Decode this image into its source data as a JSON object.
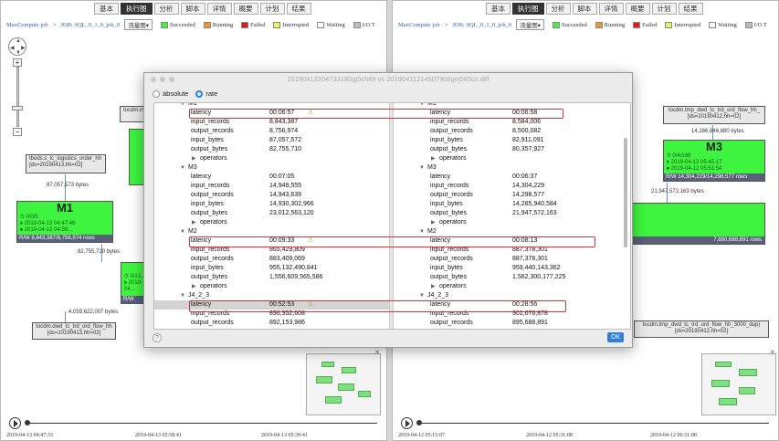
{
  "tabs": [
    "基本",
    "执行图",
    "分析",
    "脚本",
    "详情",
    "概要",
    "计划",
    "结果"
  ],
  "active_tab_index": 1,
  "left": {
    "breadcrumb_root": "MaxCompute job",
    "breadcrumb_sep": ">",
    "breadcrumb_job": "JOB: SQL_0_1_0_job_0",
    "view_select": "流量图",
    "node_top_a": "tocdm.mp...",
    "node_src_line1": "tbods.s_lc_logistics_order_hh",
    "node_src_line2": "[ds=20190413,hh=02]",
    "edge_src_label": "87,057,573 bytes",
    "m1_title": "M1",
    "m1_line1": "⏱ 0/0/5",
    "m1_line2": "⏵ 2019-04-13 04:47:46",
    "m1_line3": "⏹ 2019-04-13 04:56:..",
    "m1_rw": "R/W  8,843,387/8,756,974 rows",
    "m2_line1": "⏱ 0/13...",
    "m2_line2": "⏵ 2019-04...",
    "m2_rw": "R/W",
    "edge_m1_label": "82,755,710 bytes",
    "edge_out_label": "4,059,622,007 bytes",
    "sink_line1": "tocdm.dwd_tc_trd_ord_flow_hh",
    "sink_line2": "[ds=20190413,hh=02]",
    "mid_stub": "R/W",
    "time_start": "2019-04-13 04:47:33",
    "time_mid": "2019-04-13 05:58:41",
    "time_end": "2019-04-13 05:39:41"
  },
  "right": {
    "breadcrumb_root": "MaxCompute job",
    "breadcrumb_sep": ">",
    "breadcrumb_job": "JOB: SQL_0_1_0_job_0",
    "view_select": "流量图",
    "node_top_line1": "tocdm.tmp_dwd_tc_trd_ord_flow_hh_",
    "node_top_line2": "[ds=20190412,hh=02]",
    "edge_top_label": "14,286,946,880 bytes",
    "m3_title": "M3",
    "m3_line1": "⏱ 0/4/168",
    "m3_line2": "⏵ 2019-04-12 05:45:17",
    "m3_line3": "⏹ 2019-04-12 05:51:54",
    "m3_rw": "R/W  14,304,229/14,298,577 rows",
    "edge_m3_label": "21,947,572,163 bytes",
    "right_stub_rw": "7,880,688,891 rows",
    "sink_line1": "tocdm.tmp_dwd_tc_trd_ord_flow_hh_3000_dup)",
    "sink_line2": "[ds=20190412,hh=02]",
    "time_start": "2019-04-12 05:15:07",
    "time_mid": "2019-04-12 05:31:08",
    "time_end": "2019-04-12 06:31:08"
  },
  "legend": [
    {
      "label": "Succeeded",
      "color": "#3ef43e"
    },
    {
      "label": "Running",
      "color": "#f2932b"
    },
    {
      "label": "Failed",
      "color": "#e11b1b"
    },
    {
      "label": "Interrupted",
      "color": "#eef55a"
    },
    {
      "label": "Waiting",
      "color": "#ffffff"
    },
    {
      "label": "I/O T",
      "color": "#bdbdbd"
    }
  ],
  "dialog": {
    "title": "20190412204733180gj5ch89 vs 20190411214507908gej565cs.diff",
    "radio_absolute": "absolute",
    "radio_rate": "rate",
    "selected_radio": "rate",
    "help": "?",
    "ok": "OK",
    "left_rows": [
      {
        "k": "M1",
        "v": "",
        "type": "section"
      },
      {
        "k": "latency",
        "v": "00:06:57",
        "type": "item",
        "warn": true
      },
      {
        "k": "input_records",
        "v": "8,843,387",
        "type": "item"
      },
      {
        "k": "output_records",
        "v": "8,756,974",
        "type": "item"
      },
      {
        "k": "input_bytes",
        "v": "87,057,572",
        "type": "item"
      },
      {
        "k": "output_bytes",
        "v": "82,755,710",
        "type": "item"
      },
      {
        "k": "operators",
        "v": "",
        "type": "collapsed"
      },
      {
        "k": "M3",
        "v": "",
        "type": "section"
      },
      {
        "k": "latency",
        "v": "00:07:05",
        "type": "item"
      },
      {
        "k": "input_records",
        "v": "14,949,555",
        "type": "item"
      },
      {
        "k": "output_records",
        "v": "14,943,639",
        "type": "item"
      },
      {
        "k": "input_bytes",
        "v": "14,930,302,966",
        "type": "item"
      },
      {
        "k": "output_bytes",
        "v": "23,012,563,120",
        "type": "item"
      },
      {
        "k": "operators",
        "v": "",
        "type": "collapsed"
      },
      {
        "k": "M2",
        "v": "",
        "type": "section"
      },
      {
        "k": "latency",
        "v": "00:09:33",
        "type": "item",
        "warn": true
      },
      {
        "k": "input_records",
        "v": "865,429,809",
        "type": "item"
      },
      {
        "k": "output_records",
        "v": "883,409,069",
        "type": "item"
      },
      {
        "k": "input_bytes",
        "v": "955,132,490,841",
        "type": "item"
      },
      {
        "k": "output_bytes",
        "v": "1,556,609,565,586",
        "type": "item"
      },
      {
        "k": "operators",
        "v": "",
        "type": "collapsed"
      },
      {
        "k": "J4_2_3",
        "v": "",
        "type": "section"
      },
      {
        "k": "latency",
        "v": "00:52:53",
        "type": "item",
        "warn": true,
        "highlight": true
      },
      {
        "k": "input_records",
        "v": "896,352,608",
        "type": "item"
      },
      {
        "k": "output_records",
        "v": "892,153,986",
        "type": "item"
      }
    ],
    "right_rows": [
      {
        "k": "M1",
        "v": "",
        "type": "section"
      },
      {
        "k": "latency",
        "v": "00:06:58",
        "type": "item"
      },
      {
        "k": "input_records",
        "v": "8,584,006",
        "type": "item"
      },
      {
        "k": "output_records",
        "v": "8,500,082",
        "type": "item"
      },
      {
        "k": "input_bytes",
        "v": "82,911,091",
        "type": "item"
      },
      {
        "k": "output_bytes",
        "v": "80,357,927",
        "type": "item"
      },
      {
        "k": "operators",
        "v": "",
        "type": "collapsed"
      },
      {
        "k": "M3",
        "v": "",
        "type": "section"
      },
      {
        "k": "latency",
        "v": "00:06:37",
        "type": "item"
      },
      {
        "k": "input_records",
        "v": "14,304,229",
        "type": "item"
      },
      {
        "k": "output_records",
        "v": "14,298,577",
        "type": "item"
      },
      {
        "k": "input_bytes",
        "v": "14,285,940,584",
        "type": "item"
      },
      {
        "k": "output_bytes",
        "v": "21,947,572,163",
        "type": "item"
      },
      {
        "k": "operators",
        "v": "",
        "type": "collapsed"
      },
      {
        "k": "M2",
        "v": "",
        "type": "section"
      },
      {
        "k": "latency",
        "v": "00:08:13",
        "type": "item"
      },
      {
        "k": "input_records",
        "v": "887,378,301",
        "type": "item"
      },
      {
        "k": "output_records",
        "v": "887,378,301",
        "type": "item"
      },
      {
        "k": "input_bytes",
        "v": "959,440,143,362",
        "type": "item"
      },
      {
        "k": "output_bytes",
        "v": "1,562,300,177,225",
        "type": "item"
      },
      {
        "k": "operators",
        "v": "",
        "type": "collapsed"
      },
      {
        "k": "J4_2_3",
        "v": "",
        "type": "section"
      },
      {
        "k": "latency",
        "v": "00:28:56",
        "type": "item"
      },
      {
        "k": "input_records",
        "v": "901,676,878",
        "type": "item"
      },
      {
        "k": "output_records",
        "v": "895,688,891",
        "type": "item"
      }
    ]
  }
}
